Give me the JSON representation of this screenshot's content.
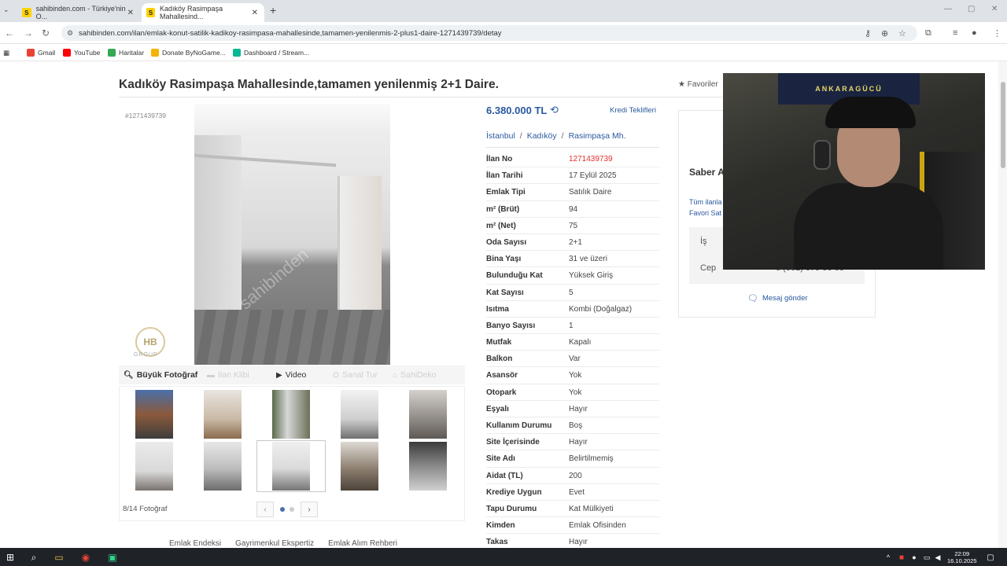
{
  "browser": {
    "tabs": [
      {
        "label": "sahibinden.com - Türkiye'nin O..."
      },
      {
        "label": "Kadıköy Rasimpaşa Mahallesind..."
      }
    ],
    "url": "sahibinden.com/ilan/emlak-konut-satilik-kadikoy-rasimpasa-mahallesinde,tamamen-yenilenmis-2-plus1-daire-1271439739/detay",
    "bookmarks": [
      {
        "label": "Gmail",
        "color": "#e94235"
      },
      {
        "label": "YouTube",
        "color": "#ff0000"
      },
      {
        "label": "Haritalar",
        "color": "#34a853"
      },
      {
        "label": "Donate ByNoGame...",
        "color": "#f4b400"
      },
      {
        "label": "Dashboard / Stream...",
        "color": "#00b894"
      }
    ]
  },
  "listing": {
    "title": "Kadıköy Rasimpaşa Mahallesinde,tamamen yenilenmiş 2+1 Daire.",
    "favorites_label": "Favoriler",
    "id_label": "#1271439739",
    "photo_tools": {
      "big_photo": "Büyük Fotoğraf",
      "listing_video": "İlan Klibi",
      "video": "Video",
      "virtual_tour": "Sanal Tur",
      "sahiocku": "SahiDeko"
    },
    "photo_count": "8/14 Fotoğraf",
    "price": "6.380.000 TL",
    "credit_offers": "Kredi Teklifleri",
    "breadcrumbs": [
      "İstanbul",
      "Kadıköy",
      "Rasimpaşa Mh."
    ],
    "details": [
      {
        "key": "İlan No",
        "value": "1271439739",
        "highlight": true
      },
      {
        "key": "İlan Tarihi",
        "value": "17 Eylül 2025"
      },
      {
        "key": "Emlak Tipi",
        "value": "Satılık Daire"
      },
      {
        "key": "m² (Brüt)",
        "value": "94"
      },
      {
        "key": "m² (Net)",
        "value": "75"
      },
      {
        "key": "Oda Sayısı",
        "value": "2+1"
      },
      {
        "key": "Bina Yaşı",
        "value": "31 ve üzeri"
      },
      {
        "key": "Bulunduğu Kat",
        "value": "Yüksek Giriş"
      },
      {
        "key": "Kat Sayısı",
        "value": "5"
      },
      {
        "key": "Isıtma",
        "value": "Kombi (Doğalgaz)"
      },
      {
        "key": "Banyo Sayısı",
        "value": "1"
      },
      {
        "key": "Mutfak",
        "value": "Kapalı"
      },
      {
        "key": "Balkon",
        "value": "Var"
      },
      {
        "key": "Asansör",
        "value": "Yok"
      },
      {
        "key": "Otopark",
        "value": "Yok"
      },
      {
        "key": "Eşyalı",
        "value": "Hayır"
      },
      {
        "key": "Kullanım Durumu",
        "value": "Boş"
      },
      {
        "key": "Site İçerisinde",
        "value": "Hayır"
      },
      {
        "key": "Site Adı",
        "value": "Belirtilmemiş"
      },
      {
        "key": "Aidat (TL)",
        "value": "200"
      },
      {
        "key": "Krediye Uygun",
        "value": "Evet"
      },
      {
        "key": "Tapu Durumu",
        "value": "Kat Mülkiyeti"
      },
      {
        "key": "Kimden",
        "value": "Emlak Ofisinden"
      },
      {
        "key": "Takas",
        "value": "Hayır"
      }
    ],
    "footer_links": [
      "Emlak Endeksi",
      "Gayrimenkul Ekspertiz",
      "Emlak Alım Rehberi"
    ]
  },
  "seller": {
    "name": "Saber A",
    "all_listings": "Tüm ilanla",
    "favorite_seller": "Favori Sat",
    "phone_work_label": "İş",
    "phone_mobile_label": "Cep",
    "phone_mobile_value": "0 (561) 679 56 00",
    "send_message": "Mesaj gönder"
  },
  "webcam": {
    "banner_text": "ANKARAGÜCÜ"
  },
  "taskbar": {
    "time": "22:09",
    "date": "16.10.2025"
  },
  "colors": {
    "link_blue": "#2a5a9e",
    "id_red": "#e2312d",
    "brand_yellow": "#ffd200"
  }
}
